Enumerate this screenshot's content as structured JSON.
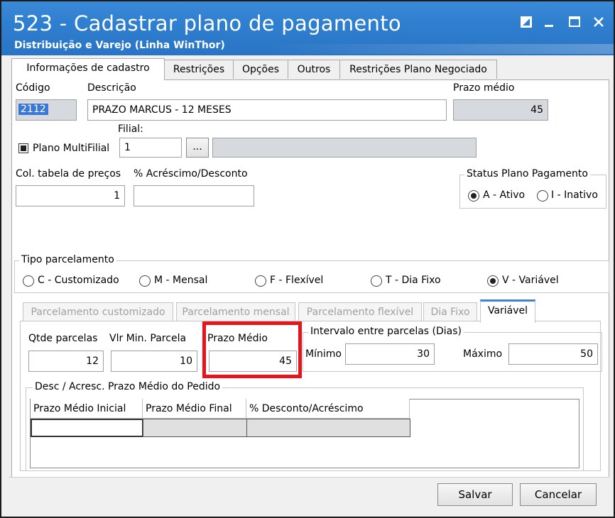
{
  "window": {
    "title": "523 - Cadastrar plano de pagamento",
    "subtitle": "Distribuição e Varejo (Linha WinThor)",
    "controls": [
      "restore-icon",
      "minimize-icon",
      "maximize-icon",
      "close-icon"
    ]
  },
  "tabs": [
    {
      "label": "Informações de cadastro",
      "active": true
    },
    {
      "label": "Restrições"
    },
    {
      "label": "Opções"
    },
    {
      "label": "Outros"
    },
    {
      "label": "Restrições Plano Negociado"
    }
  ],
  "form": {
    "codigo_label": "Código",
    "codigo_value": "2112",
    "descricao_label": "Descrição",
    "descricao_value": "PRAZO MARCUS - 12 MESES",
    "prazo_medio_label": "Prazo médio",
    "prazo_medio_value": "45",
    "filial_label": "Filial:",
    "multifilial_label": "Plano MultiFilial",
    "filial_value": "1",
    "filial_button": "...",
    "col_tabela_label": "Col. tabela de preços",
    "col_tabela_value": "1",
    "acrescimo_label": "% Acréscimo/Desconto",
    "acrescimo_value": "",
    "status_title": "Status Plano Pagamento",
    "status_ativo": "A - Ativo",
    "status_inativo": "I - Inativo"
  },
  "tipo_parcelamento": {
    "title": "Tipo parcelamento",
    "options": [
      "C - Customizado",
      "M - Mensal",
      "F - Flexível",
      "T - Dia Fixo",
      "V - Variável"
    ],
    "selected": "V - Variável"
  },
  "subtabs": [
    {
      "label": "Parcelamento customizado"
    },
    {
      "label": "Parcelamento mensal"
    },
    {
      "label": "Parcelamento flexível"
    },
    {
      "label": "Dia Fixo"
    },
    {
      "label": "Variável",
      "active": true
    }
  ],
  "variavel": {
    "qtde_label": "Qtde parcelas",
    "qtde_value": "12",
    "vlr_min_label": "Vlr Min. Parcela",
    "vlr_min_value": "10",
    "prazo_medio_label": "Prazo Médio",
    "prazo_medio_value": "45",
    "intervalo_title": "Intervalo entre parcelas (Dias)",
    "minimo_label": "Mínimo",
    "minimo_value": "30",
    "maximo_label": "Máximo",
    "maximo_value": "50",
    "desc_title": "Desc / Acresc. Prazo Médio do Pedido",
    "columns": [
      "Prazo Médio Inicial",
      "Prazo Médio Final",
      "% Desconto/Acréscimo"
    ]
  },
  "footer": {
    "save_label": "Salvar",
    "cancel_label": "Cancelar"
  },
  "colors": {
    "titlebar": "#2f7fd0",
    "highlight": "#e8141b",
    "selection": "#3b78d6",
    "active_tab_accent": "#3c82d6"
  }
}
